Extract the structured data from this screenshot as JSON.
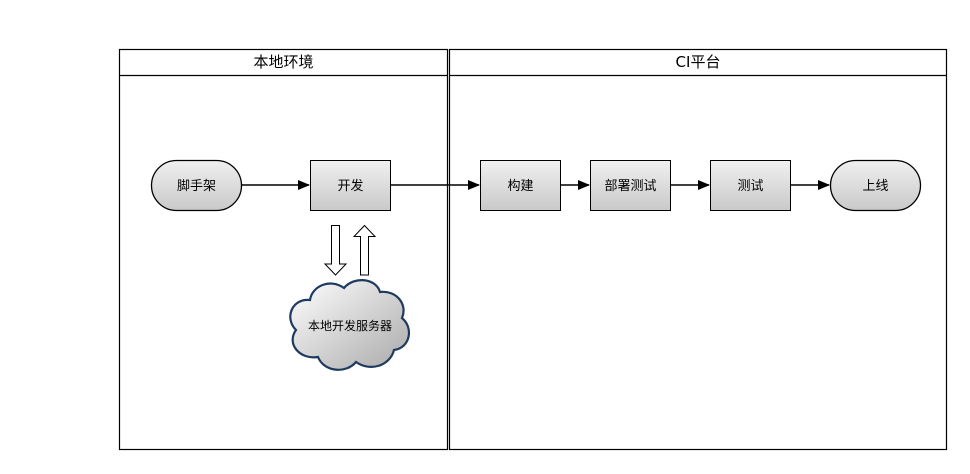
{
  "lanes": {
    "local": {
      "title": "本地环境"
    },
    "ci": {
      "title": "CI平台"
    }
  },
  "nodes": {
    "scaffold": "脚手架",
    "develop": "开发",
    "local_server": "本地开发服务器",
    "build": "构建",
    "deploy_test": "部署测试",
    "test": "测试",
    "release": "上线"
  },
  "colors": {
    "stroke": "#000000",
    "cloud_stroke": "#1f3a5f",
    "fill_light": "#f2f2f2",
    "fill_dark": "#c8c8c8"
  }
}
